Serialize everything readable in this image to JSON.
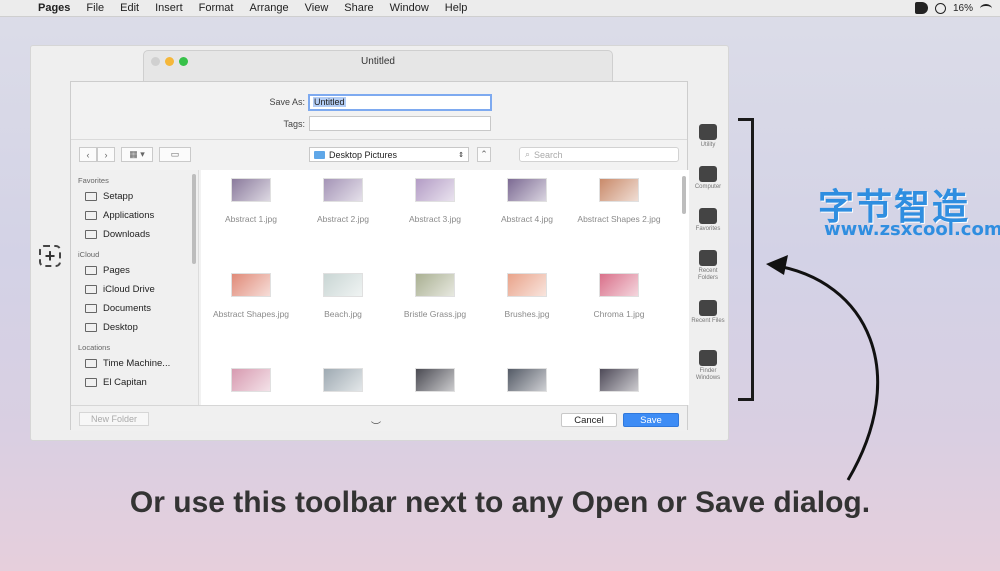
{
  "menubar": {
    "items": [
      "Pages",
      "File",
      "Edit",
      "Insert",
      "Format",
      "Arrange",
      "View",
      "Share",
      "Window",
      "Help"
    ],
    "battery": "16%"
  },
  "window": {
    "title": "Untitled"
  },
  "dialog": {
    "save_as_label": "Save As:",
    "save_as_value": "Untitled",
    "tags_label": "Tags:",
    "tags_value": "",
    "location": "Desktop Pictures",
    "search_placeholder": "Search",
    "new_folder": "New Folder",
    "cancel": "Cancel",
    "save": "Save"
  },
  "sidebar": {
    "sections": [
      {
        "title": "Favorites",
        "items": [
          "Setapp",
          "Applications",
          "Downloads"
        ]
      },
      {
        "title": "iCloud",
        "items": [
          "Pages",
          "iCloud Drive",
          "Documents",
          "Desktop"
        ]
      },
      {
        "title": "Locations",
        "items": [
          "Time Machine...",
          "El Capitan"
        ]
      }
    ]
  },
  "files": [
    {
      "name": "Abstract 1.jpg",
      "color": "#8a7a9c"
    },
    {
      "name": "Abstract 2.jpg",
      "color": "#a494b6"
    },
    {
      "name": "Abstract 3.jpg",
      "color": "#b39cc5"
    },
    {
      "name": "Abstract 4.jpg",
      "color": "#7c6a93"
    },
    {
      "name": "Abstract Shapes 2.jpg",
      "color": "#c98a6a"
    },
    {
      "name": "Abstract Shapes.jpg",
      "color": "#e08a78"
    },
    {
      "name": "Beach.jpg",
      "color": "#c9d6d4"
    },
    {
      "name": "Bristle Grass.jpg",
      "color": "#aab092"
    },
    {
      "name": "Brushes.jpg",
      "color": "#e9a38a"
    },
    {
      "name": "Chroma 1.jpg",
      "color": "#d9708a"
    },
    {
      "name": "",
      "color": "#d79ab0"
    },
    {
      "name": "",
      "color": "#9eaab2"
    },
    {
      "name": "",
      "color": "#4a4a52"
    },
    {
      "name": "",
      "color": "#545a66"
    },
    {
      "name": "",
      "color": "#4e4a58"
    }
  ],
  "toolbar": [
    {
      "label": "Utility",
      "icon": "d-logo-icon"
    },
    {
      "label": "Computer",
      "icon": "monitor-icon"
    },
    {
      "label": "Favorites",
      "icon": "heart-icon"
    },
    {
      "label": "Recent Folders",
      "icon": "folder-clock-icon"
    },
    {
      "label": "Recent Files",
      "icon": "file-clock-icon"
    },
    {
      "label": "Finder Windows",
      "icon": "finder-icon"
    }
  ],
  "logo": {
    "cn": "字节智造",
    "url": "www.zsxcool.com"
  },
  "caption": "Or use this toolbar next to any Open or Save dialog."
}
